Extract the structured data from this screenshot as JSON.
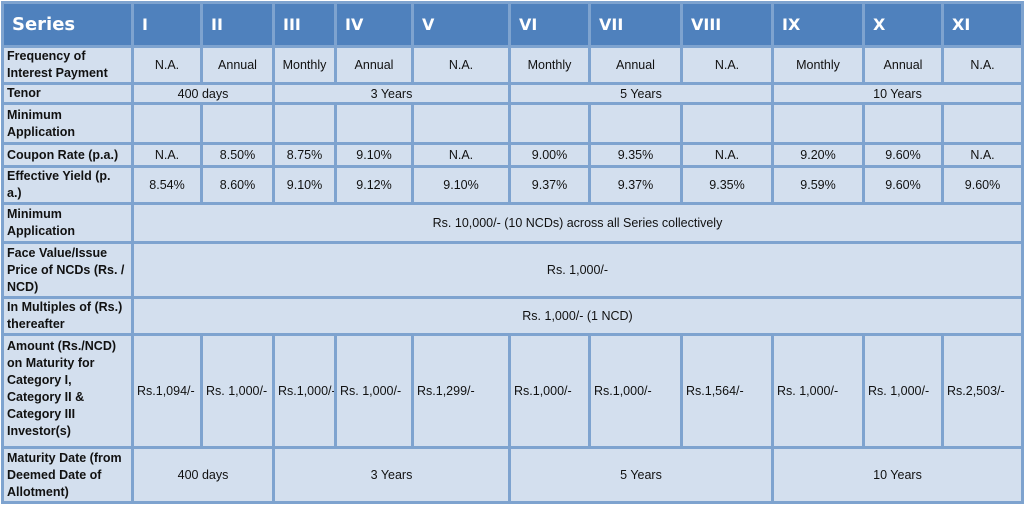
{
  "header": {
    "series_label": "Series",
    "series": [
      "I",
      "II",
      "III",
      "IV",
      "V",
      "VI",
      "VII",
      "VIII",
      "IX",
      "X",
      "XI"
    ]
  },
  "rows": {
    "frequency": {
      "label": "Frequency of Interest Payment",
      "values": [
        "N.A.",
        "Annual",
        "Monthly",
        "Annual",
        "N.A.",
        "Monthly",
        "Annual",
        "N.A.",
        "Monthly",
        "Annual",
        "N.A."
      ]
    },
    "tenor": {
      "label": "Tenor",
      "groups": [
        "400 days",
        "3 Years",
        "5 Years",
        "10 Years"
      ]
    },
    "minimum_application_blank": {
      "label": "Minimum Application"
    },
    "coupon_rate": {
      "label": "Coupon Rate (p.a.)",
      "values": [
        "N.A.",
        "8.50%",
        "8.75%",
        "9.10%",
        "N.A.",
        "9.00%",
        "9.35%",
        "N.A.",
        "9.20%",
        "9.60%",
        "N.A."
      ]
    },
    "effective_yield": {
      "label": "Effective Yield (p. a.)",
      "values": [
        "8.54%",
        "8.60%",
        "9.10%",
        "9.12%",
        "9.10%",
        "9.37%",
        "9.37%",
        "9.35%",
        "9.59%",
        "9.60%",
        "9.60%"
      ]
    },
    "minimum_application": {
      "label": "Minimum Application",
      "value": "Rs. 10,000/- (10 NCDs) across all Series collectively"
    },
    "face_value": {
      "label": "Face Value/Issue Price of NCDs (Rs. / NCD)",
      "value": "Rs. 1,000/-"
    },
    "multiples": {
      "label": "In Multiples of (Rs.) thereafter",
      "value": "Rs. 1,000/- (1 NCD)"
    },
    "amount_on_maturity": {
      "label": "Amount (Rs./NCD) on Maturity for Category I, Category II & Category III Investor(s)",
      "values": [
        "Rs.1,094/-",
        "Rs. 1,000/-",
        "Rs.1,000/-",
        "Rs. 1,000/-",
        "Rs.1,299/-",
        "Rs.1,000/-",
        "Rs.1,000/-",
        "Rs.1,564/-",
        "Rs. 1,000/-",
        "Rs. 1,000/-",
        "Rs.2,503/-"
      ]
    },
    "maturity_date": {
      "label": "Maturity Date (from Deemed Date of Allotment)",
      "groups": [
        "400 days",
        "3 Years",
        "5 Years",
        "10 Years"
      ]
    }
  }
}
